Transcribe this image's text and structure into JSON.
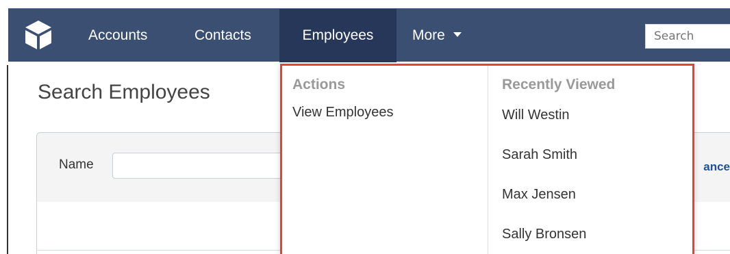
{
  "nav": {
    "items": [
      {
        "label": "Accounts"
      },
      {
        "label": "Contacts"
      },
      {
        "label": "Employees"
      },
      {
        "label": "More"
      }
    ],
    "search_placeholder": "Search"
  },
  "page": {
    "title": "Search Employees"
  },
  "filter": {
    "name_label": "Name",
    "name_value": "",
    "advanced_link_visible": "ance"
  },
  "dropdown": {
    "actions_heading": "Actions",
    "actions": [
      {
        "label": "View Employees"
      }
    ],
    "recent_heading": "Recently Viewed",
    "recent": [
      {
        "label": "Will Westin"
      },
      {
        "label": "Sarah Smith"
      },
      {
        "label": "Max Jensen"
      },
      {
        "label": "Sally Bronsen"
      }
    ]
  },
  "colors": {
    "navbar": "#3b4f72",
    "nav_active": "#26375a",
    "highlight_border": "#e8412d",
    "link": "#1d4f9c"
  }
}
